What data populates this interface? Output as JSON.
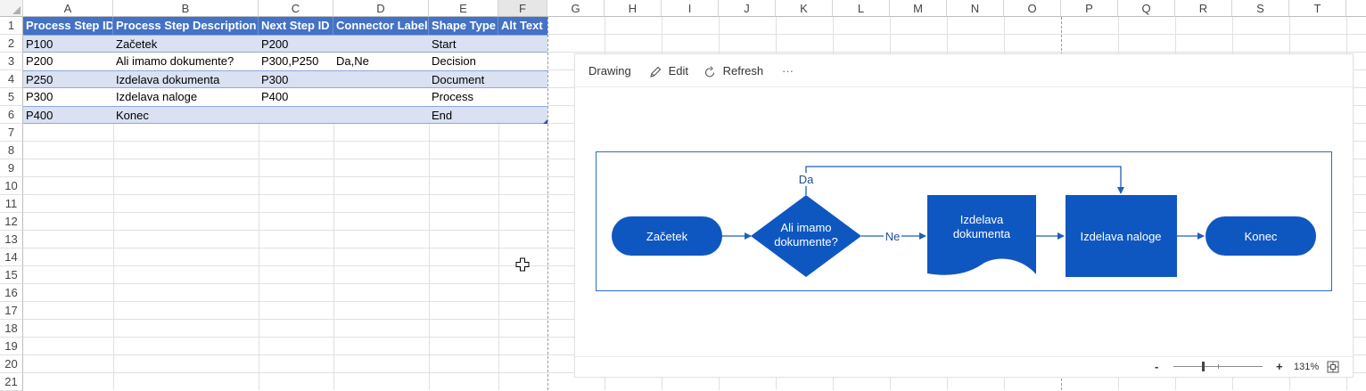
{
  "columns": [
    "A",
    "B",
    "C",
    "D",
    "E",
    "F",
    "G",
    "H",
    "I",
    "J",
    "K",
    "L",
    "M",
    "N",
    "O",
    "P",
    "Q",
    "R",
    "S",
    "T"
  ],
  "rows": [
    "1",
    "2",
    "3",
    "4",
    "5",
    "6",
    "7",
    "8",
    "9",
    "10",
    "11",
    "12",
    "13",
    "14",
    "15",
    "16",
    "17",
    "18",
    "19",
    "20",
    "21"
  ],
  "table": {
    "headers": [
      "Process Step ID",
      "Process Step Description",
      "Next Step ID",
      "Connector Label",
      "Shape Type",
      "Alt Text"
    ],
    "rows": [
      [
        "P100",
        "Začetek",
        "P200",
        "",
        "Start",
        ""
      ],
      [
        "P200",
        "Ali imamo dokumente?",
        "P300,P250",
        "Da,Ne",
        "Decision",
        ""
      ],
      [
        "P250",
        "Izdelava dokumenta",
        "P300",
        "",
        "Document",
        ""
      ],
      [
        "P300",
        "Izdelava naloge",
        "P400",
        "",
        "Process",
        ""
      ],
      [
        "P400",
        "Konec",
        "",
        "",
        "End",
        ""
      ]
    ]
  },
  "drawing": {
    "toolbar": {
      "title": "Drawing",
      "edit_label": "Edit",
      "refresh_label": "Refresh",
      "more_label": "···"
    },
    "flowchart": {
      "start_label": "Začetek",
      "decision_line1": "Ali imamo",
      "decision_line2": "dokumente?",
      "document_line1": "Izdelava",
      "document_line2": "dokumenta",
      "process_label": "Izdelava naloge",
      "end_label": "Konec",
      "connector_yes": "Da",
      "connector_no": "Ne",
      "shape_fill": "#0f57c0",
      "line_color": "#1f5fb8"
    },
    "status": {
      "zoom_out": "-",
      "zoom_in": "+",
      "zoom_level": 131,
      "zoom_text": "131%",
      "slider_fraction": 0.33
    }
  }
}
